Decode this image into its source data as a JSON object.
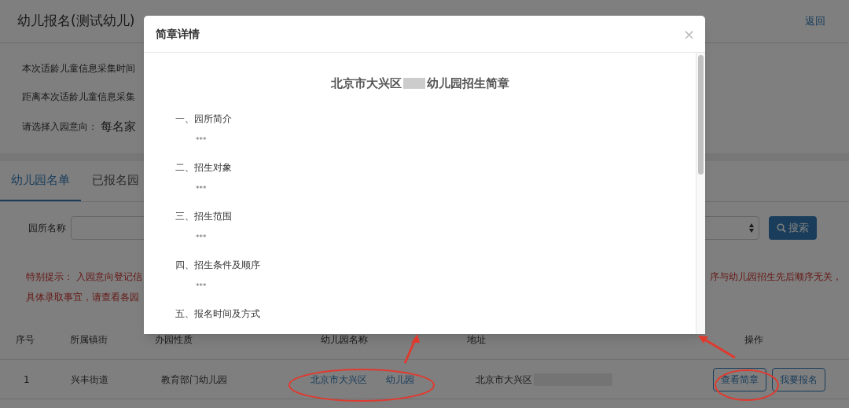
{
  "page": {
    "title": "幼儿报名(测试幼儿)",
    "back_link": "返回",
    "info_lines": [
      "本次适龄儿童信息采集时间",
      "距离本次适龄儿童信息采集"
    ],
    "intent_label": "请选择入园意向：",
    "intent_note": "每名家"
  },
  "tabs": [
    {
      "label": "幼儿园名单",
      "selected": true
    },
    {
      "label": "已报名园",
      "selected": false
    }
  ],
  "search": {
    "label": "园所名称",
    "button": "搜索"
  },
  "notice": {
    "line_1": "特别提示： 入园意向登记信",
    "line_1_end": "序与幼儿园招生先后顺序无关，",
    "line_2": "具体录取事宜，请查看各园"
  },
  "table": {
    "columns": [
      "序号",
      "所属镇街",
      "办园性质",
      "幼儿园名称",
      "地址",
      "操作"
    ],
    "rows": [
      {
        "index": "1",
        "town": "兴丰街道",
        "type": "教育部门幼儿园",
        "name_start": "北京市大兴区",
        "name_end": "幼儿园",
        "address": "北京市大兴区",
        "actions": [
          "查看简章",
          "我要报名"
        ]
      }
    ]
  },
  "modal": {
    "title": "简章详情",
    "close": "×",
    "heading_start": "北京市大兴区",
    "heading_end": "幼儿园招生简章",
    "sections": [
      {
        "title": "一、园所简介",
        "body": "***"
      },
      {
        "title": "二、招生对象",
        "body": "***"
      },
      {
        "title": "三、招生范围",
        "body": "***"
      },
      {
        "title": "四、招生条件及顺序",
        "body": "***"
      },
      {
        "title": "五、报名时间及方式"
      }
    ]
  }
}
